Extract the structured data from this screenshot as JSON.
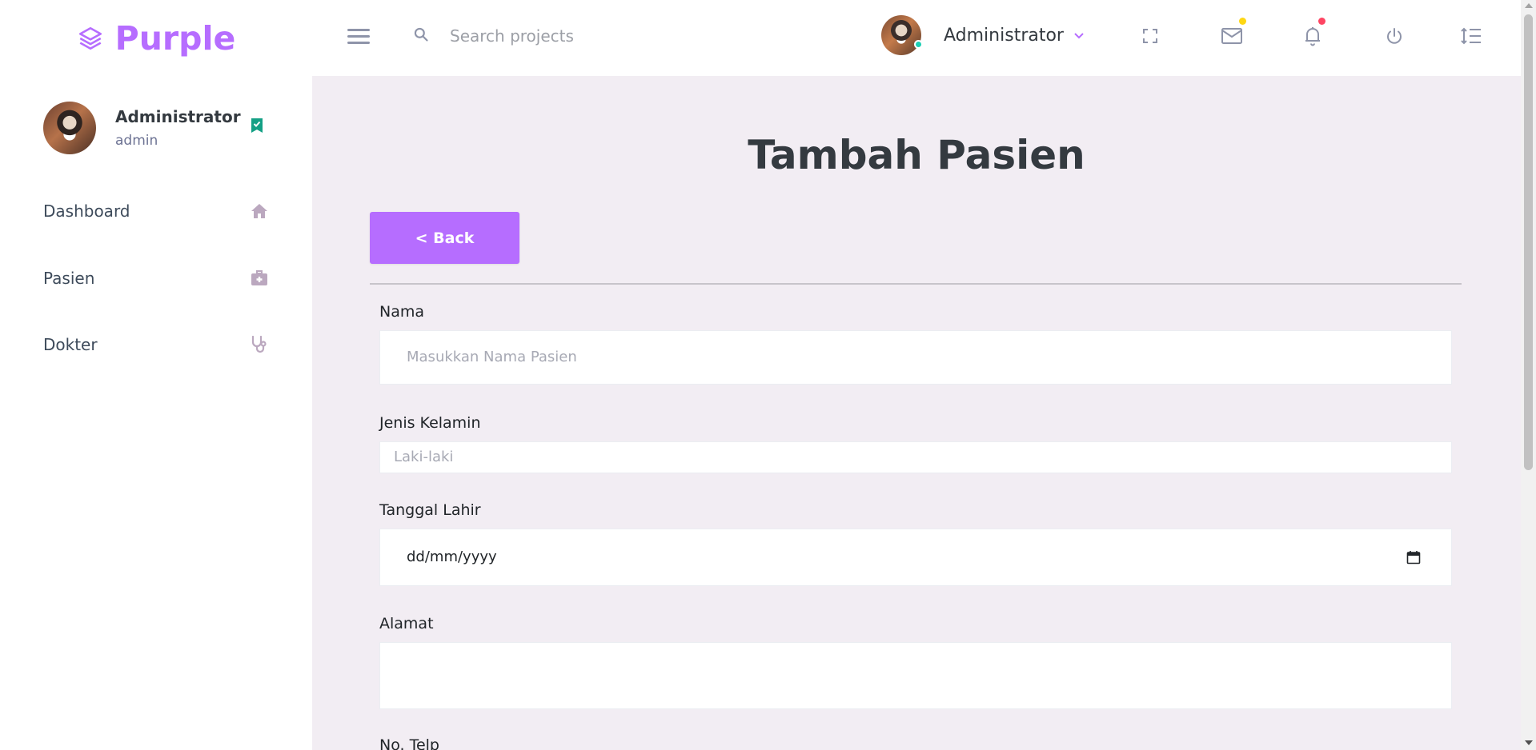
{
  "brand": {
    "name": "Purple",
    "color": "#b66dff",
    "logo_icon": "layers-icon"
  },
  "navbar": {
    "menu_icon": "hamburger-icon",
    "search": {
      "icon": "search-icon",
      "placeholder": "Search projects",
      "value": ""
    },
    "user": {
      "name": "Administrator",
      "caret": "⌄",
      "status": "online"
    },
    "icons": [
      "fullscreen-icon",
      "mail-icon",
      "bell-icon",
      "power-icon",
      "format-line-spacing-icon"
    ],
    "mail_dot_color": "#fed713",
    "bell_dot_color": "#fe7c96"
  },
  "sidebar": {
    "profile": {
      "name": "Administrator",
      "role": "admin",
      "badge_icon": "bookmark-check-icon",
      "badge_color": "#1bcfb4"
    },
    "items": [
      {
        "label": "Dashboard",
        "icon": "home-icon"
      },
      {
        "label": "Pasien",
        "icon": "medical-bag-icon"
      },
      {
        "label": "Dokter",
        "icon": "stethoscope-icon"
      }
    ]
  },
  "main": {
    "title": "Tambah Pasien",
    "back_button": "< Back",
    "form": {
      "nama": {
        "label": "Nama",
        "placeholder": "Masukkan Nama Pasien",
        "value": ""
      },
      "jenis_kelamin": {
        "label": "Jenis Kelamin",
        "selected": "Laki-laki"
      },
      "tanggal_lahir": {
        "label": "Tanggal Lahir",
        "placeholder": "dd/mm/yyyy",
        "icon": "calendar-icon"
      },
      "alamat": {
        "label": "Alamat",
        "value": ""
      },
      "no_telp": {
        "label": "No. Telp"
      }
    }
  },
  "colors": {
    "accent": "#b66dff",
    "background": "#f2edf3",
    "icon_muted": "#c3a6c9"
  }
}
